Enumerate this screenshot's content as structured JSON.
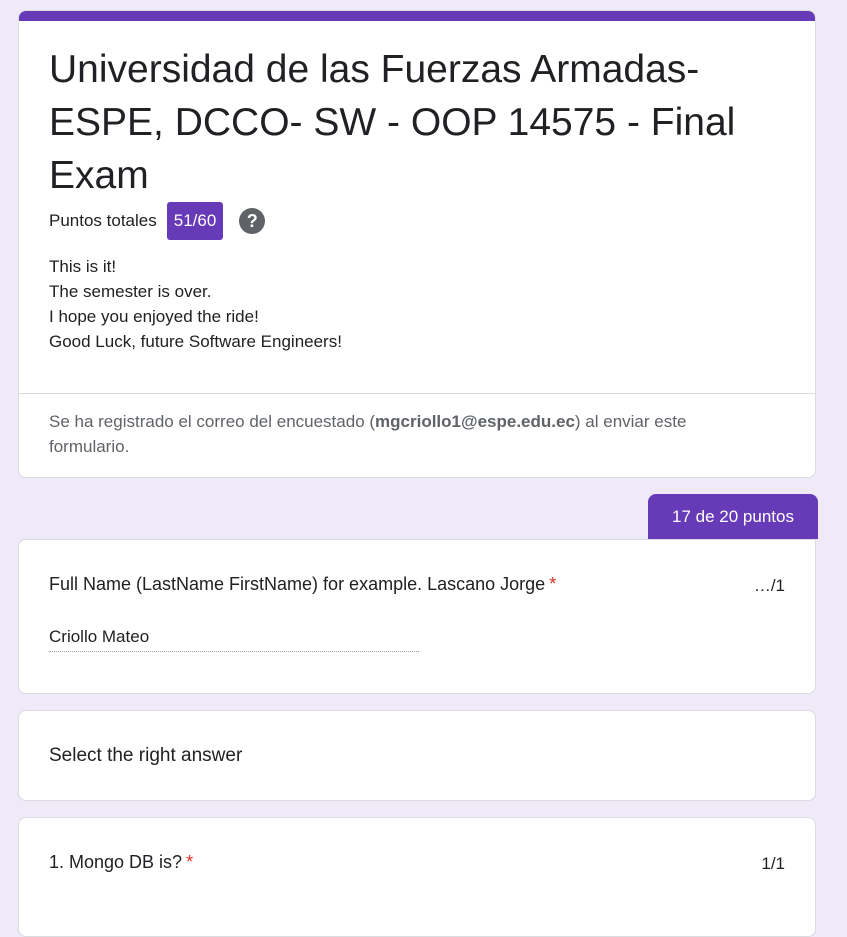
{
  "header": {
    "title": "Universidad de las Fuerzas Armadas- ESPE, DCCO- SW - OOP 14575 - Final Exam",
    "points_label": "Puntos totales",
    "points_value": "51/60",
    "help_icon": "help-circle-icon",
    "description_lines": [
      "This is it!",
      "The semester is over.",
      "I hope you enjoyed the ride!",
      "Good Luck, future Software Engineers!"
    ],
    "email_note_prefix": "Se ha registrado el correo del encuestado (",
    "email": "mgcriollo1@espe.edu.ec",
    "email_note_suffix": ") al enviar este formulario."
  },
  "section_score": "17 de 20 puntos",
  "questions": [
    {
      "title": "Full Name (LastName FirstName) for example. Lascano Jorge",
      "required_mark": "*",
      "score": "…/1",
      "answer": "Criollo Mateo"
    },
    {
      "title": "1. Mongo DB is?",
      "required_mark": "*",
      "score": "1/1"
    }
  ],
  "section": {
    "title": "Select the right answer"
  },
  "colors": {
    "accent": "#673ab7",
    "background": "#efe9f8",
    "required": "#d93025"
  }
}
